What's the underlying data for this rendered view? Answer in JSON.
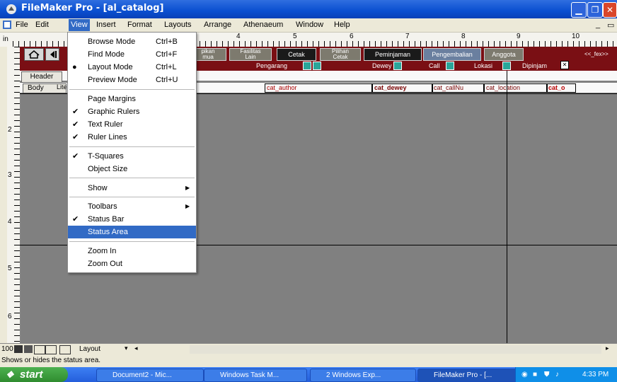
{
  "window": {
    "title": "FileMaker Pro - [al_catalog]"
  },
  "menubar": {
    "items": [
      "File",
      "Edit",
      "View",
      "Insert",
      "Format",
      "Layouts",
      "Arrange",
      "Athenaeum",
      "Window",
      "Help"
    ],
    "selected": "View"
  },
  "ruler": {
    "numbers": [
      "4",
      "5",
      "6",
      "7",
      "8",
      "9",
      "10"
    ],
    "vnumbers": [
      "2",
      "3",
      "4",
      "5",
      "6"
    ]
  },
  "layout": {
    "nav_buttons": [
      "pikan\nmua",
      "Fasilitas\nLain",
      "Cetak",
      "Pilihan\nCetak",
      "Peminjaman",
      "Pengembalian",
      "Anggota"
    ],
    "nav_right": "<<_fex>>",
    "sort_labels": {
      "pengarang": "Pengarang",
      "dewey": "Dewey",
      "call": "Call",
      "lokasi": "Lokasi",
      "dipinjam": "Dipinjam"
    },
    "parts": {
      "header": "Header",
      "body": "Body"
    },
    "body_label_fragment": "Lite",
    "fields": [
      "cat_author",
      "cat_dewey",
      "cat_callNu",
      "cat_location",
      "cat_o"
    ]
  },
  "view_menu": {
    "items": [
      {
        "label": "Browse Mode",
        "shortcut": "Ctrl+B"
      },
      {
        "label": "Find Mode",
        "shortcut": "Ctrl+F"
      },
      {
        "label": "Layout Mode",
        "shortcut": "Ctrl+L",
        "bullet": true
      },
      {
        "label": "Preview Mode",
        "shortcut": "Ctrl+U"
      },
      {
        "label": "Page Margins"
      },
      {
        "label": "Graphic Rulers",
        "checked": true
      },
      {
        "label": "Text Ruler",
        "checked": true
      },
      {
        "label": "Ruler Lines",
        "checked": true
      },
      {
        "label": "T-Squares",
        "checked": true
      },
      {
        "label": "Object Size"
      },
      {
        "label": "Show",
        "submenu": true
      },
      {
        "label": "Toolbars",
        "submenu": true
      },
      {
        "label": "Status Bar",
        "checked": true
      },
      {
        "label": "Status Area",
        "highlighted": true
      },
      {
        "label": "Zoom In"
      },
      {
        "label": "Zoom Out"
      }
    ]
  },
  "bottom": {
    "zoom": "100",
    "mode": "Layout",
    "status_text": "Shows or hides the status area."
  },
  "taskbar": {
    "start": "start",
    "tasks": [
      "Document2 - Mic...",
      "Windows Task M...",
      "2 Windows Exp...",
      "FileMaker Pro - [..."
    ],
    "clock": "4:33 PM"
  },
  "colors": {
    "accent": "#316ac5",
    "layout_band": "#7a0f14",
    "canvas": "#808080"
  }
}
